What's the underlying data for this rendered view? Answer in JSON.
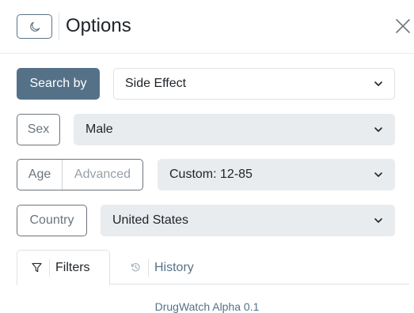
{
  "header": {
    "title": "Options",
    "theme_icon": "moon-icon",
    "close_icon": "close-icon"
  },
  "search": {
    "label": "Search by",
    "value": "Side Effect"
  },
  "sex": {
    "label": "Sex",
    "value": "Male"
  },
  "age": {
    "label": "Age",
    "advanced_label": "Advanced",
    "value": "Custom: 12-85"
  },
  "country": {
    "label": "Country",
    "value": "United States"
  },
  "tabs": [
    {
      "label": "Filters",
      "icon": "filter-icon",
      "active": true
    },
    {
      "label": "History",
      "icon": "history-icon",
      "active": false
    }
  ],
  "footer": {
    "text": "DrugWatch Alpha 0.1"
  },
  "colors": {
    "accent": "#557187",
    "select_grey": "#e9ecef",
    "border": "#6c757d"
  }
}
